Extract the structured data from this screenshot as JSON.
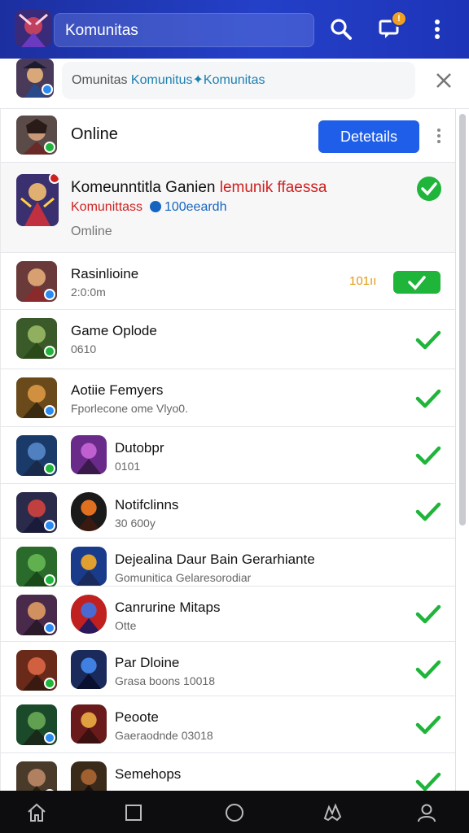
{
  "appbar": {
    "search_value": "Komunitas",
    "notification_count": "!"
  },
  "suggestion": {
    "text_plain": "Omunitas",
    "text_highlight": "Komunitus✦Komunitas"
  },
  "online_header": {
    "title": "Online",
    "details_label": "Detetails"
  },
  "featured": {
    "title_black": "Komeunntitla Ganien",
    "title_red": "lemunik ffaessa",
    "line2_red": "Komunittass",
    "line2_blue": "100eeardh",
    "status": "Omline"
  },
  "items": [
    {
      "title": "Rasinlioine",
      "sub": "2:0:0m",
      "extra": "101ıı",
      "state": "toggle"
    },
    {
      "title": "Game Oplode",
      "sub": "0610",
      "extra": "",
      "state": "check"
    },
    {
      "title": "Aotiie Femyers",
      "sub": "Fporlecone ome Vlyo0.",
      "extra": "",
      "state": "check"
    },
    {
      "title": "Dutobpr",
      "sub": "0101",
      "extra": "",
      "state": "check"
    },
    {
      "title": "Notifclinns",
      "sub": "30 600y",
      "extra": "",
      "state": "check"
    },
    {
      "title": "Dejealina Daur Bain Gerarhiante",
      "sub": "Gomunitica Gelaresorodiar",
      "extra": "",
      "state": "none"
    },
    {
      "title": "Canrurine Mitaps",
      "sub": "Otte",
      "extra": "",
      "state": "check"
    },
    {
      "title": "Par Dloine",
      "sub": "Grasa boons 10018",
      "extra": "",
      "state": "check"
    },
    {
      "title": "Peoote",
      "sub": "Gaeraodnde 03018",
      "extra": "",
      "state": "check"
    },
    {
      "title": "Semehops",
      "sub": "",
      "extra": "",
      "state": "check"
    }
  ],
  "colors": {
    "appbar": "#1d34b8",
    "accent_button": "#1f5ee8",
    "check_green": "#1fb53a",
    "highlight_red": "#d02020",
    "highlight_blue": "#1565c0",
    "orange": "#e09a10"
  },
  "icons": [
    "search-icon",
    "chat-icon",
    "more-vert-icon",
    "close-icon",
    "check-icon",
    "home-icon",
    "square-icon",
    "circle-icon",
    "gesture-icon",
    "profile-icon"
  ]
}
